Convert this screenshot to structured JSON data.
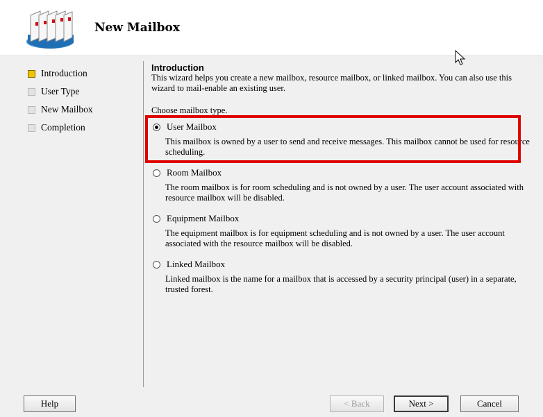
{
  "window": {
    "title": "New Mailbox"
  },
  "nav": {
    "items": [
      {
        "label": "Introduction",
        "active": true
      },
      {
        "label": "User Type",
        "active": false
      },
      {
        "label": "New Mailbox",
        "active": false
      },
      {
        "label": "Completion",
        "active": false
      }
    ]
  },
  "content": {
    "heading": "Introduction",
    "intro": "This wizard helps you create a new mailbox, resource mailbox, or linked mailbox. You can also use this wizard to mail-enable an existing user.",
    "choose_label": "Choose mailbox type.",
    "options": [
      {
        "label": "User Mailbox",
        "selected": true,
        "description": "This mailbox is owned by a user to send and receive messages. This mailbox cannot be used for resource scheduling."
      },
      {
        "label": "Room Mailbox",
        "selected": false,
        "description": "The room mailbox is for room scheduling and is not owned by a user. The user account associated with resource mailbox will be disabled."
      },
      {
        "label": "Equipment Mailbox",
        "selected": false,
        "description": "The equipment mailbox is for equipment scheduling and is not owned by a user. The user account associated with the resource mailbox will be disabled."
      },
      {
        "label": "Linked Mailbox",
        "selected": false,
        "description": "Linked mailbox is the name for a mailbox that is accessed by a security principal (user) in a separate, trusted forest."
      }
    ]
  },
  "buttons": {
    "help": "Help",
    "back": "< Back",
    "next": "Next >",
    "cancel": "Cancel"
  },
  "colors": {
    "highlight": "#e00000",
    "active_step": "#f3c200"
  }
}
